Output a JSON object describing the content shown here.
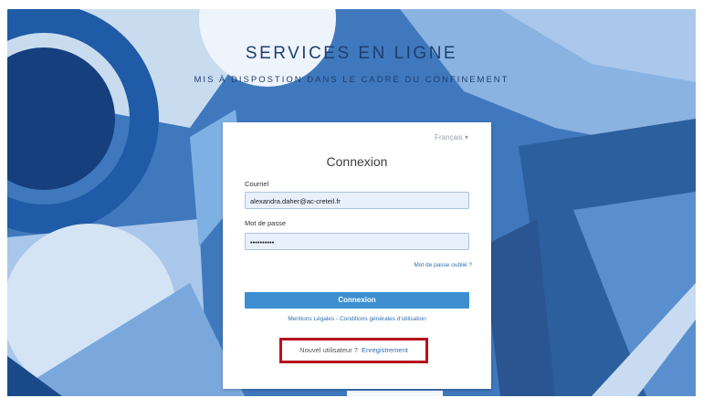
{
  "hero": {
    "title": "SERVICES EN LIGNE",
    "subtitle": "MIS À DISPOSTION DANS LE CADRE DU CONFINEMENT"
  },
  "login": {
    "language": "Français ▾",
    "title": "Connexion",
    "email_label": "Courriel",
    "email_value": "alexandra.daher@ac-creteil.fr",
    "password_label": "Mot de passe",
    "password_value": "••••••••••",
    "forgot_link": "Mot de passe oublié ?",
    "submit_label": "Connexion",
    "legal_mentions": "Mentions Légales",
    "legal_separator": " - ",
    "legal_terms": "Conditions générales d'utilisation",
    "new_user_text": "Nouvel utilisateur ?",
    "register_link": "Enregistrement"
  },
  "colors": {
    "background": "#3f78bd",
    "button": "#3d8fd2",
    "link": "#2e6fb2",
    "highlight_box": "#b5121b"
  }
}
